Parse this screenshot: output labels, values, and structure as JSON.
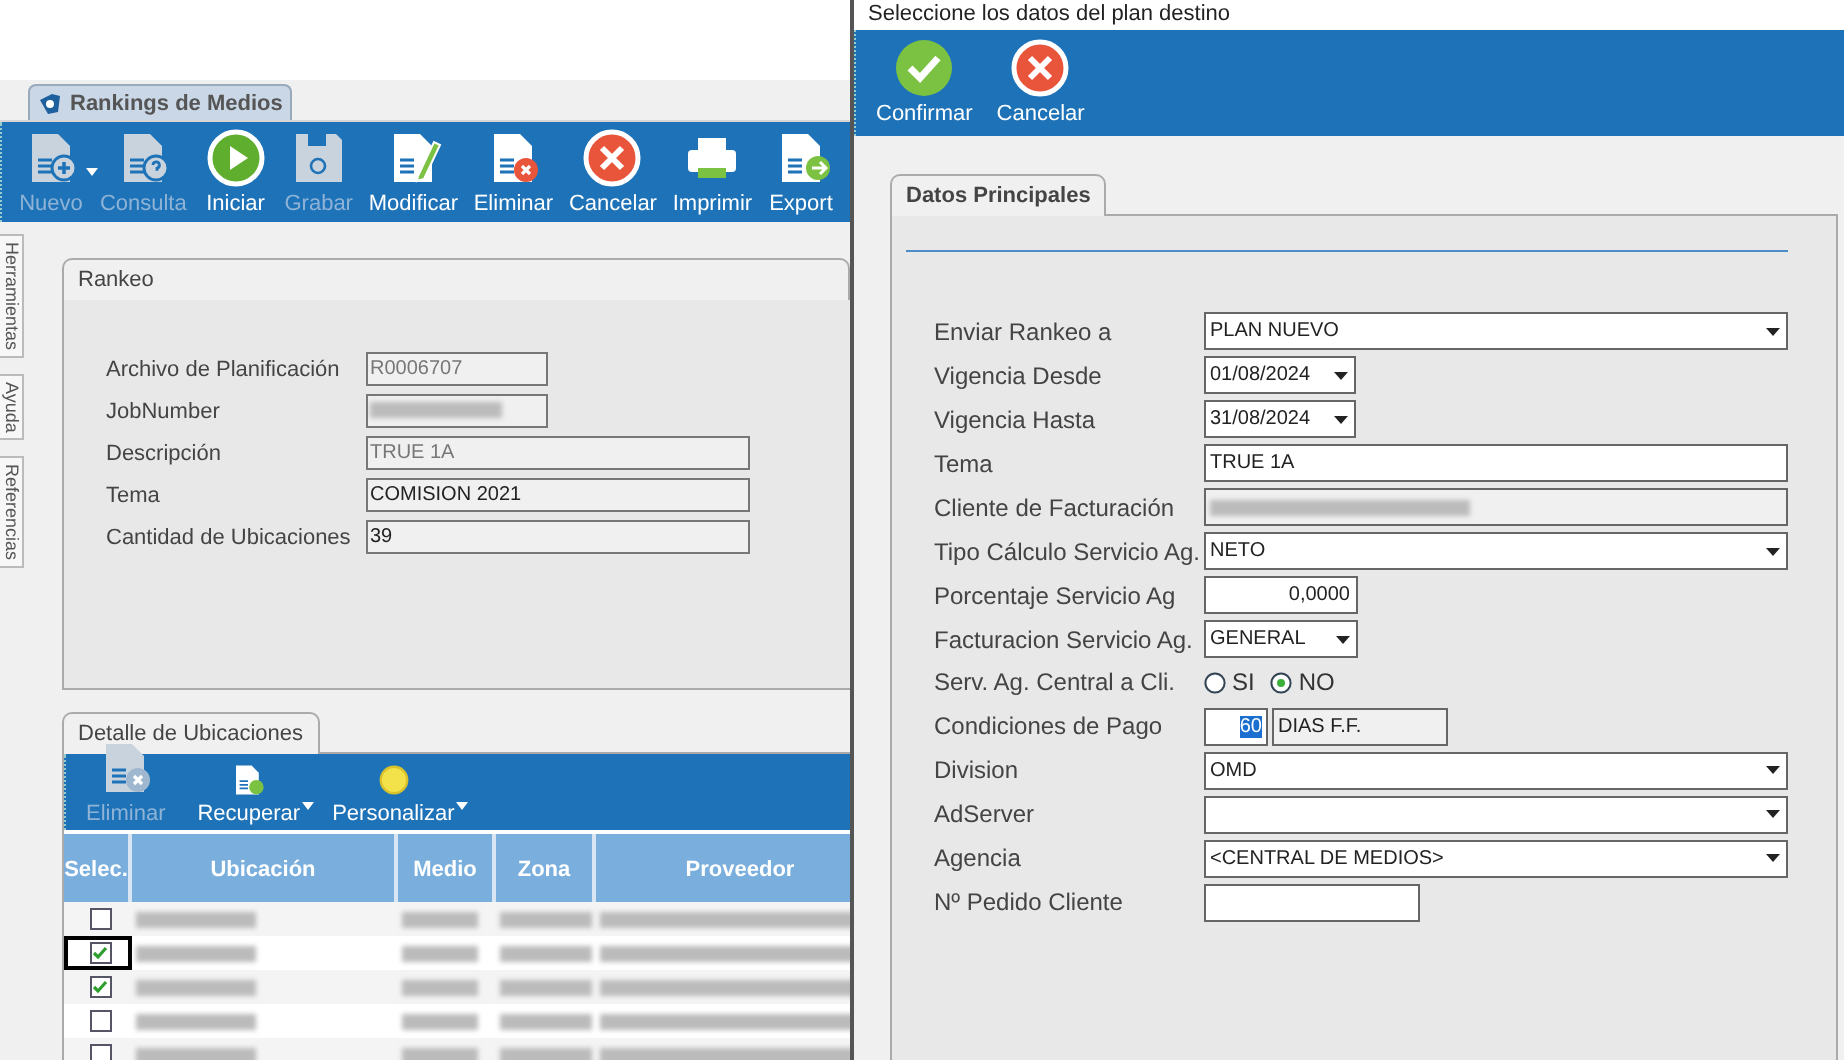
{
  "main_window": {
    "tab": {
      "label": "Rankings de Medios",
      "selected": true
    },
    "toolbar": [
      {
        "label": "Nuevo",
        "kind": "new",
        "disabled": true,
        "dropdown": true
      },
      {
        "label": "Consulta",
        "kind": "query",
        "disabled": true,
        "dropdown": false
      },
      {
        "label": "Iniciar",
        "kind": "play",
        "disabled": false,
        "dropdown": false
      },
      {
        "label": "Grabar",
        "kind": "save",
        "disabled": true,
        "dropdown": false
      },
      {
        "label": "Modificar",
        "kind": "edit",
        "disabled": false,
        "dropdown": false
      },
      {
        "label": "Eliminar",
        "kind": "delete",
        "disabled": false,
        "dropdown": false
      },
      {
        "label": "Cancelar",
        "kind": "cancel",
        "disabled": false,
        "dropdown": false
      },
      {
        "label": "Imprimir",
        "kind": "print",
        "disabled": false,
        "dropdown": false
      },
      {
        "label": "Export",
        "kind": "export",
        "disabled": false,
        "dropdown": false
      }
    ],
    "side_tabs": [
      "Herramientas",
      "Ayuda",
      "Referencias"
    ],
    "rankeo": {
      "tab": "Rankeo",
      "fields": [
        {
          "kind": "short",
          "label": "Archivo de Planificación",
          "value": "R0006707",
          "disabled": true
        },
        {
          "kind": "redacted",
          "label": "JobNumber"
        },
        {
          "kind": "long",
          "label": "Descripción",
          "value": "TRUE 1A",
          "disabled": true
        },
        {
          "kind": "long",
          "label": "Tema",
          "value": "COMISION 2021",
          "disabled": false
        },
        {
          "kind": "long",
          "label": "Cantidad de Ubicaciones",
          "value": "39",
          "disabled": false
        }
      ]
    },
    "detalle": {
      "tab": "Detalle de Ubicaciones",
      "toolbar": [
        {
          "label": "Eliminar",
          "kind": "delete",
          "disabled": true,
          "dropdown": false
        },
        {
          "label": "Recuperar",
          "kind": "recover",
          "disabled": false,
          "dropdown": true
        },
        {
          "label": "Personalizar",
          "kind": "customize",
          "disabled": false,
          "dropdown": true
        }
      ],
      "columns": [
        "Selec.",
        "Ubicación",
        "Medio",
        "Zona",
        "Proveedor"
      ],
      "rows": [
        {
          "checked": false,
          "focused": false
        },
        {
          "checked": true,
          "focused": true
        },
        {
          "checked": true,
          "focused": false
        },
        {
          "checked": false,
          "focused": false
        },
        {
          "checked": false,
          "focused": false
        }
      ]
    }
  },
  "dialog": {
    "title": "Seleccione los datos del plan destino",
    "toolbar": [
      {
        "label": "Confirmar",
        "kind": "confirm"
      },
      {
        "label": "Cancelar",
        "kind": "cancel"
      }
    ],
    "tab": {
      "label": "Datos Principales",
      "selected": true
    },
    "fields": [
      {
        "kind": "select",
        "label": "Enviar Rankeo a",
        "value": "PLAN NUEVO"
      },
      {
        "kind": "date",
        "label": "Vigencia Desde",
        "value": "01/08/2024"
      },
      {
        "kind": "date",
        "label": "Vigencia Hasta",
        "value": "31/08/2024"
      },
      {
        "kind": "text",
        "label": "Tema",
        "value": "TRUE 1A"
      },
      {
        "kind": "redacted",
        "label": "Cliente de Facturación"
      },
      {
        "kind": "select",
        "label": "Tipo Cálculo Servicio Ag.",
        "value": "NETO"
      },
      {
        "kind": "number",
        "label": "Porcentaje Servicio Ag",
        "value": "0,0000"
      },
      {
        "kind": "short_select",
        "label": "Facturacion Servicio Ag.",
        "value": "GENERAL"
      },
      {
        "kind": "radio",
        "label": "Serv. Ag. Central a Cli.",
        "options": [
          {
            "label": "SI",
            "selected": false
          },
          {
            "label": "NO",
            "selected": true
          }
        ]
      },
      {
        "kind": "payment",
        "label": "Condiciones de Pago",
        "value": "60",
        "text_selected": true,
        "detail": "DIAS F.F."
      },
      {
        "kind": "select",
        "label": "Division",
        "value": "OMD"
      },
      {
        "kind": "select",
        "label": "AdServer"
      },
      {
        "kind": "select",
        "label": "Agencia",
        "value": "<CENTRAL DE MEDIOS>"
      },
      {
        "kind": "short_text",
        "label": "Nº Pedido Cliente"
      }
    ]
  }
}
